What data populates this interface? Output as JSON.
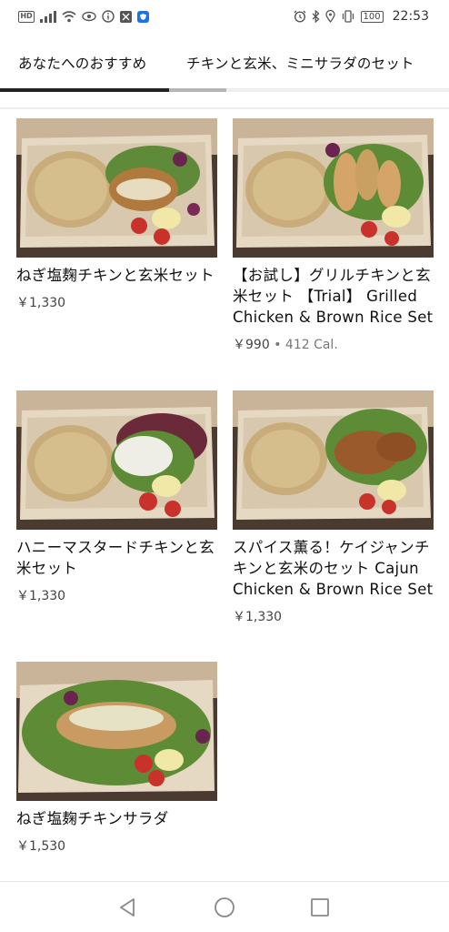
{
  "status_bar": {
    "left_icons": [
      "hd-icon",
      "signal-icon",
      "wifi-icon",
      "eye-icon",
      "info-icon",
      "app-icon",
      "shield-app-icon"
    ],
    "hd_label": "HD",
    "battery": "100",
    "time": "22:53"
  },
  "tabs": [
    {
      "label": "あなたへのおすすめ"
    },
    {
      "label": "チキンと玄米、ミニサラダのセット"
    }
  ],
  "items": [
    {
      "name": "ねぎ塩麹チキンと玄米セット",
      "price": "￥1,330",
      "calories": ""
    },
    {
      "name": "【お試し】グリルチキンと玄米セット 【Trial】 Grilled Chicken & Brown Rice Set",
      "price": "￥990",
      "calories": "412 Cal."
    },
    {
      "name": "ハニーマスタードチキンと玄米セット",
      "price": "￥1,330",
      "calories": ""
    },
    {
      "name": "スパイス薫る！ケイジャンチキンと玄米のセット Cajun Chicken & Brown Rice Set",
      "price": "￥1,330",
      "calories": ""
    },
    {
      "name": "ねぎ塩麹チキンサラダ",
      "price": "￥1,530",
      "calories": ""
    }
  ],
  "separator": "•",
  "nav": {
    "back_icon": "back-triangle-icon",
    "home_icon": "home-circle-icon",
    "recent_icon": "recent-square-icon"
  }
}
